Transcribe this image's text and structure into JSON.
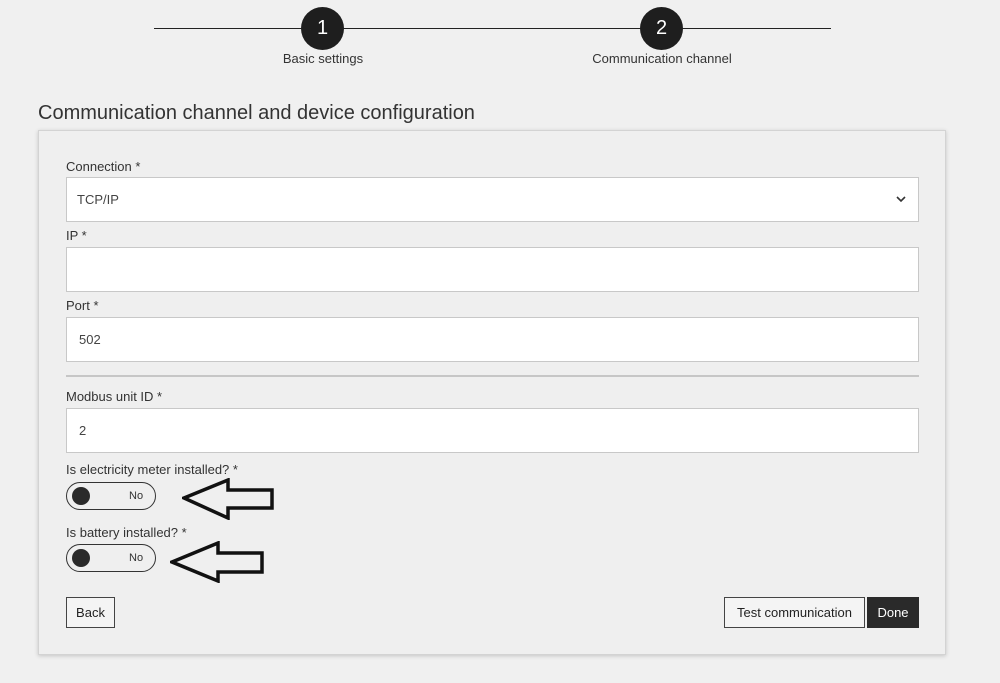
{
  "stepper": {
    "steps": [
      {
        "number": "1",
        "label": "Basic settings"
      },
      {
        "number": "2",
        "label": "Communication channel"
      }
    ]
  },
  "page": {
    "title": "Communication channel and device configuration"
  },
  "form": {
    "connection": {
      "label": "Connection *",
      "value": "TCP/IP"
    },
    "ip": {
      "label": "IP *",
      "value": ""
    },
    "port": {
      "label": "Port *",
      "value": "502"
    },
    "modbus_unit_id": {
      "label": "Modbus unit ID *",
      "value": "2"
    },
    "electricity_meter": {
      "label": "Is electricity meter installed? *",
      "state": "No"
    },
    "battery": {
      "label": "Is battery installed? *",
      "state": "No"
    }
  },
  "buttons": {
    "back": "Back",
    "test_communication": "Test communication",
    "done": "Done"
  },
  "icons": {
    "select": "chevron-down-icon",
    "annotation": "left-arrow-icon"
  }
}
